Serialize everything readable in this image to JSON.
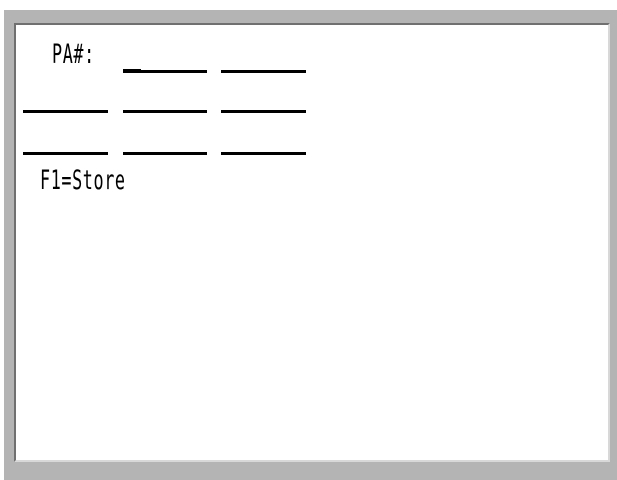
{
  "screen": {
    "pa_label": "PA#:",
    "function_keys": "F1=Store",
    "input_fields": [
      {
        "row": 1,
        "col": 1,
        "value": ""
      },
      {
        "row": 1,
        "col": 2,
        "value": ""
      },
      {
        "row": 2,
        "col": 0,
        "value": ""
      },
      {
        "row": 2,
        "col": 1,
        "value": ""
      },
      {
        "row": 2,
        "col": 2,
        "value": ""
      },
      {
        "row": 3,
        "col": 0,
        "value": ""
      },
      {
        "row": 3,
        "col": 1,
        "value": ""
      },
      {
        "row": 3,
        "col": 2,
        "value": ""
      }
    ],
    "active_field": {
      "row": 1,
      "col": 1
    }
  },
  "colors": {
    "bezel": "#b4b4b4",
    "screen_background": "#ffffff",
    "text": "#000000"
  }
}
